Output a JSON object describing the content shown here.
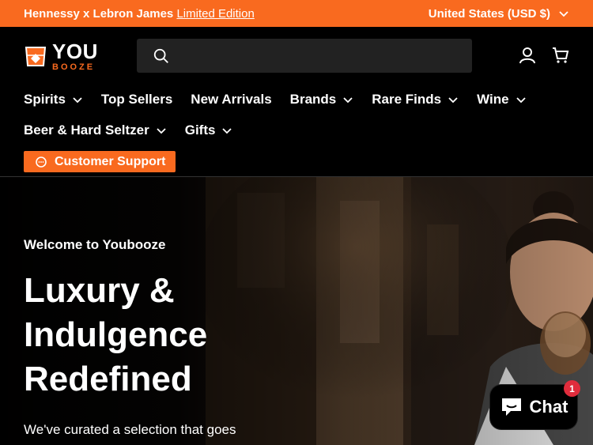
{
  "announcement": {
    "promo_text": "Hennessy x Lebron James",
    "promo_link": "Limited Edition",
    "region": "United States (USD $)"
  },
  "header": {
    "logo_main": "YOU",
    "logo_sub": "BOOZE",
    "search_placeholder": "",
    "brand_color": "#f96a1f"
  },
  "nav": {
    "row1": [
      {
        "label": "Spirits",
        "dropdown": true
      },
      {
        "label": "Top Sellers",
        "dropdown": false
      },
      {
        "label": "New Arrivals",
        "dropdown": false
      },
      {
        "label": "Brands",
        "dropdown": true
      },
      {
        "label": "Rare Finds",
        "dropdown": true
      },
      {
        "label": "Wine",
        "dropdown": true
      }
    ],
    "row2": [
      {
        "label": "Beer & Hard Seltzer",
        "dropdown": true
      },
      {
        "label": "Gifts",
        "dropdown": true
      }
    ],
    "support_label": "Customer Support"
  },
  "hero": {
    "eyebrow": "Welcome to Youbooze",
    "title": "Luxury & Indulgence Redefined",
    "body": "We've curated a selection that goes beyond the ordinary, featuring"
  },
  "chat": {
    "label": "Chat",
    "badge": "1"
  }
}
